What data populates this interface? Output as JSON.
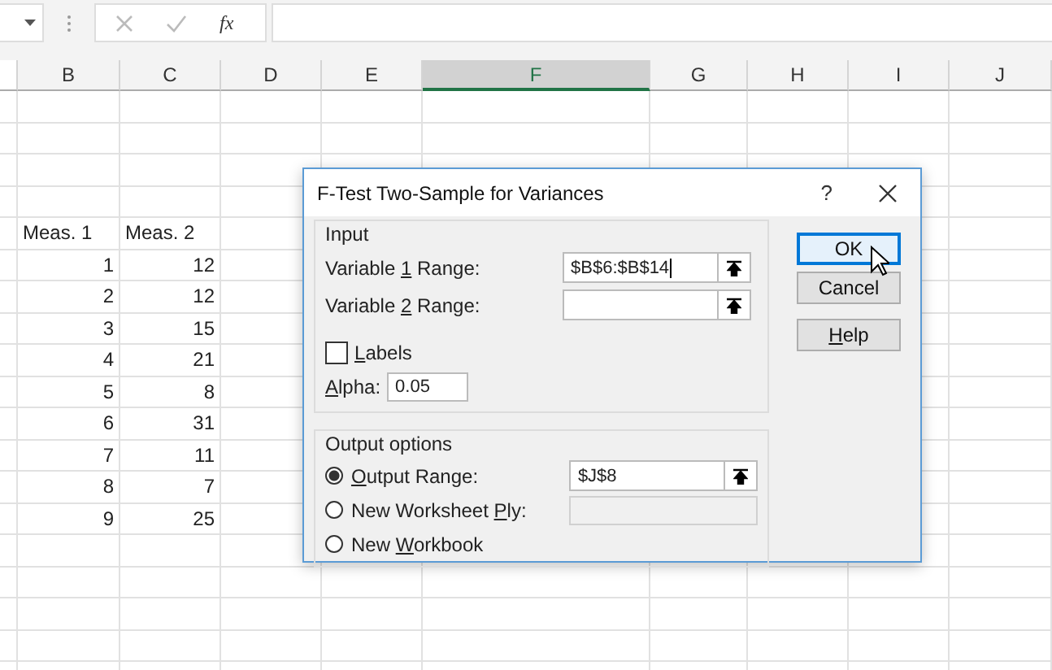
{
  "formula_bar": {
    "function_label": "fx"
  },
  "columns": [
    {
      "label": "B",
      "selected": false
    },
    {
      "label": "C",
      "selected": false
    },
    {
      "label": "D",
      "selected": false
    },
    {
      "label": "E",
      "selected": false
    },
    {
      "label": "F",
      "selected": true
    },
    {
      "label": "G",
      "selected": false
    },
    {
      "label": "H",
      "selected": false
    },
    {
      "label": "I",
      "selected": false
    },
    {
      "label": "J",
      "selected": false
    }
  ],
  "rows": [
    {
      "kind": "header",
      "cells": [
        "Meas. 1",
        "Meas. 2"
      ]
    },
    {
      "kind": "number",
      "cells": [
        "1",
        "12"
      ]
    },
    {
      "kind": "number",
      "cells": [
        "2",
        "12"
      ]
    },
    {
      "kind": "number",
      "cells": [
        "3",
        "15"
      ]
    },
    {
      "kind": "number",
      "cells": [
        "4",
        "21"
      ]
    },
    {
      "kind": "number",
      "cells": [
        "5",
        "8"
      ]
    },
    {
      "kind": "number",
      "cells": [
        "6",
        "31"
      ]
    },
    {
      "kind": "number",
      "cells": [
        "7",
        "11"
      ]
    },
    {
      "kind": "number",
      "cells": [
        "8",
        "7"
      ]
    },
    {
      "kind": "number",
      "cells": [
        "9",
        "25"
      ]
    }
  ],
  "dialog": {
    "title": "F-Test Two-Sample for Variances",
    "help": "?",
    "input": {
      "title": "Input",
      "ranges": [
        {
          "label": {
            "before": "Variable ",
            "key": "1",
            "after": " Range:"
          },
          "value": "$B$6:$B$14"
        },
        {
          "label": {
            "before": "Variable ",
            "key": "2",
            "after": " Range:"
          }
        }
      ],
      "labels_checkbox": {
        "label": {
          "key": "L",
          "after": "abels"
        },
        "checked": false
      },
      "alpha": {
        "label": {
          "key": "A",
          "after": "lpha:"
        },
        "value": "0.05"
      }
    },
    "output": {
      "title": "Output options",
      "options": [
        {
          "label": {
            "key": "O",
            "after": "utput Range:"
          },
          "selected": true,
          "value": "$J$8",
          "kind": "range"
        },
        {
          "label": {
            "before": "New Worksheet ",
            "key": "P",
            "after": "ly:"
          },
          "selected": false,
          "kind": "text",
          "disabled": true
        },
        {
          "label": {
            "before": "New ",
            "key": "W",
            "after": "orkbook"
          },
          "selected": false,
          "kind": "none"
        }
      ]
    },
    "buttons": [
      {
        "label": {
          "before": "OK"
        },
        "default": true
      },
      {
        "label": {
          "before": "Cancel"
        },
        "default": false
      },
      {
        "label": {
          "key": "H",
          "after": "elp"
        },
        "default": false
      }
    ]
  }
}
